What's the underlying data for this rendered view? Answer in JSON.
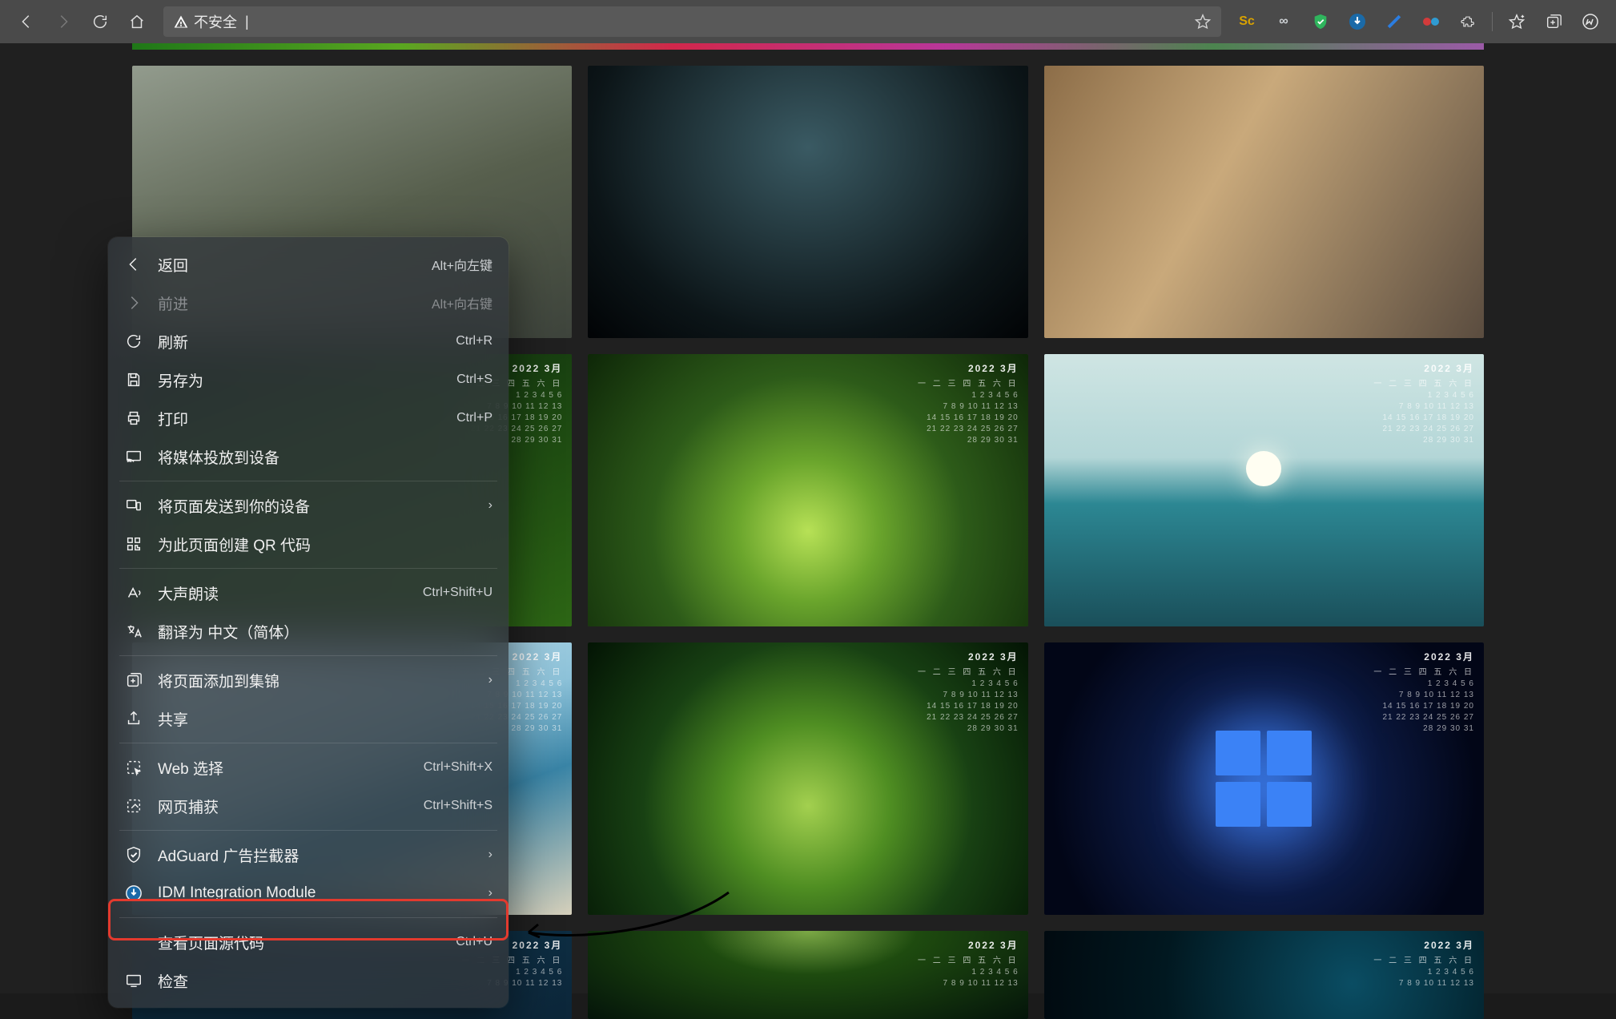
{
  "toolbar": {
    "nav": {
      "back": "返回",
      "forward": "前进",
      "refresh": "刷新",
      "home": "首页"
    },
    "url": {
      "insecure_label": "不安全",
      "divider": "|"
    },
    "extensions": [
      "Sc",
      "∞",
      "shield",
      "idm",
      "wing",
      "goggles",
      "ext",
      "fav",
      "collect",
      "copilot"
    ]
  },
  "calendar_title": "2022 3月",
  "calendar_weekdays": "一 二 三 四 五 六 日",
  "calendar_row1": "1 2 3 4 5 6",
  "calendar_row2": "7 8 9 10 11 12 13",
  "calendar_row3": "14 15 16 17 18 19 20",
  "calendar_row4": "21 22 23 24 25 26 27",
  "calendar_row5": "28 29 30 31",
  "context_menu": {
    "back": {
      "label": "返回",
      "shortcut": "Alt+向左键"
    },
    "forward": {
      "label": "前进",
      "shortcut": "Alt+向右键"
    },
    "refresh": {
      "label": "刷新",
      "shortcut": "Ctrl+R"
    },
    "save_as": {
      "label": "另存为",
      "shortcut": "Ctrl+S"
    },
    "print": {
      "label": "打印",
      "shortcut": "Ctrl+P"
    },
    "cast": {
      "label": "将媒体投放到设备"
    },
    "send_to_device": {
      "label": "将页面发送到你的设备"
    },
    "create_qr": {
      "label": "为此页面创建 QR 代码"
    },
    "read_aloud": {
      "label": "大声朗读",
      "shortcut": "Ctrl+Shift+U"
    },
    "translate": {
      "label": "翻译为 中文（简体）"
    },
    "add_to_collection": {
      "label": "将页面添加到集锦"
    },
    "share": {
      "label": "共享"
    },
    "web_select": {
      "label": "Web 选择",
      "shortcut": "Ctrl+Shift+X"
    },
    "web_capture": {
      "label": "网页捕获",
      "shortcut": "Ctrl+Shift+S"
    },
    "adguard": {
      "label": "AdGuard 广告拦截器"
    },
    "idm": {
      "label": "IDM Integration Module"
    },
    "view_source": {
      "label": "查看页面源代码",
      "shortcut": "Ctrl+U"
    },
    "inspect": {
      "label": "检查"
    }
  }
}
